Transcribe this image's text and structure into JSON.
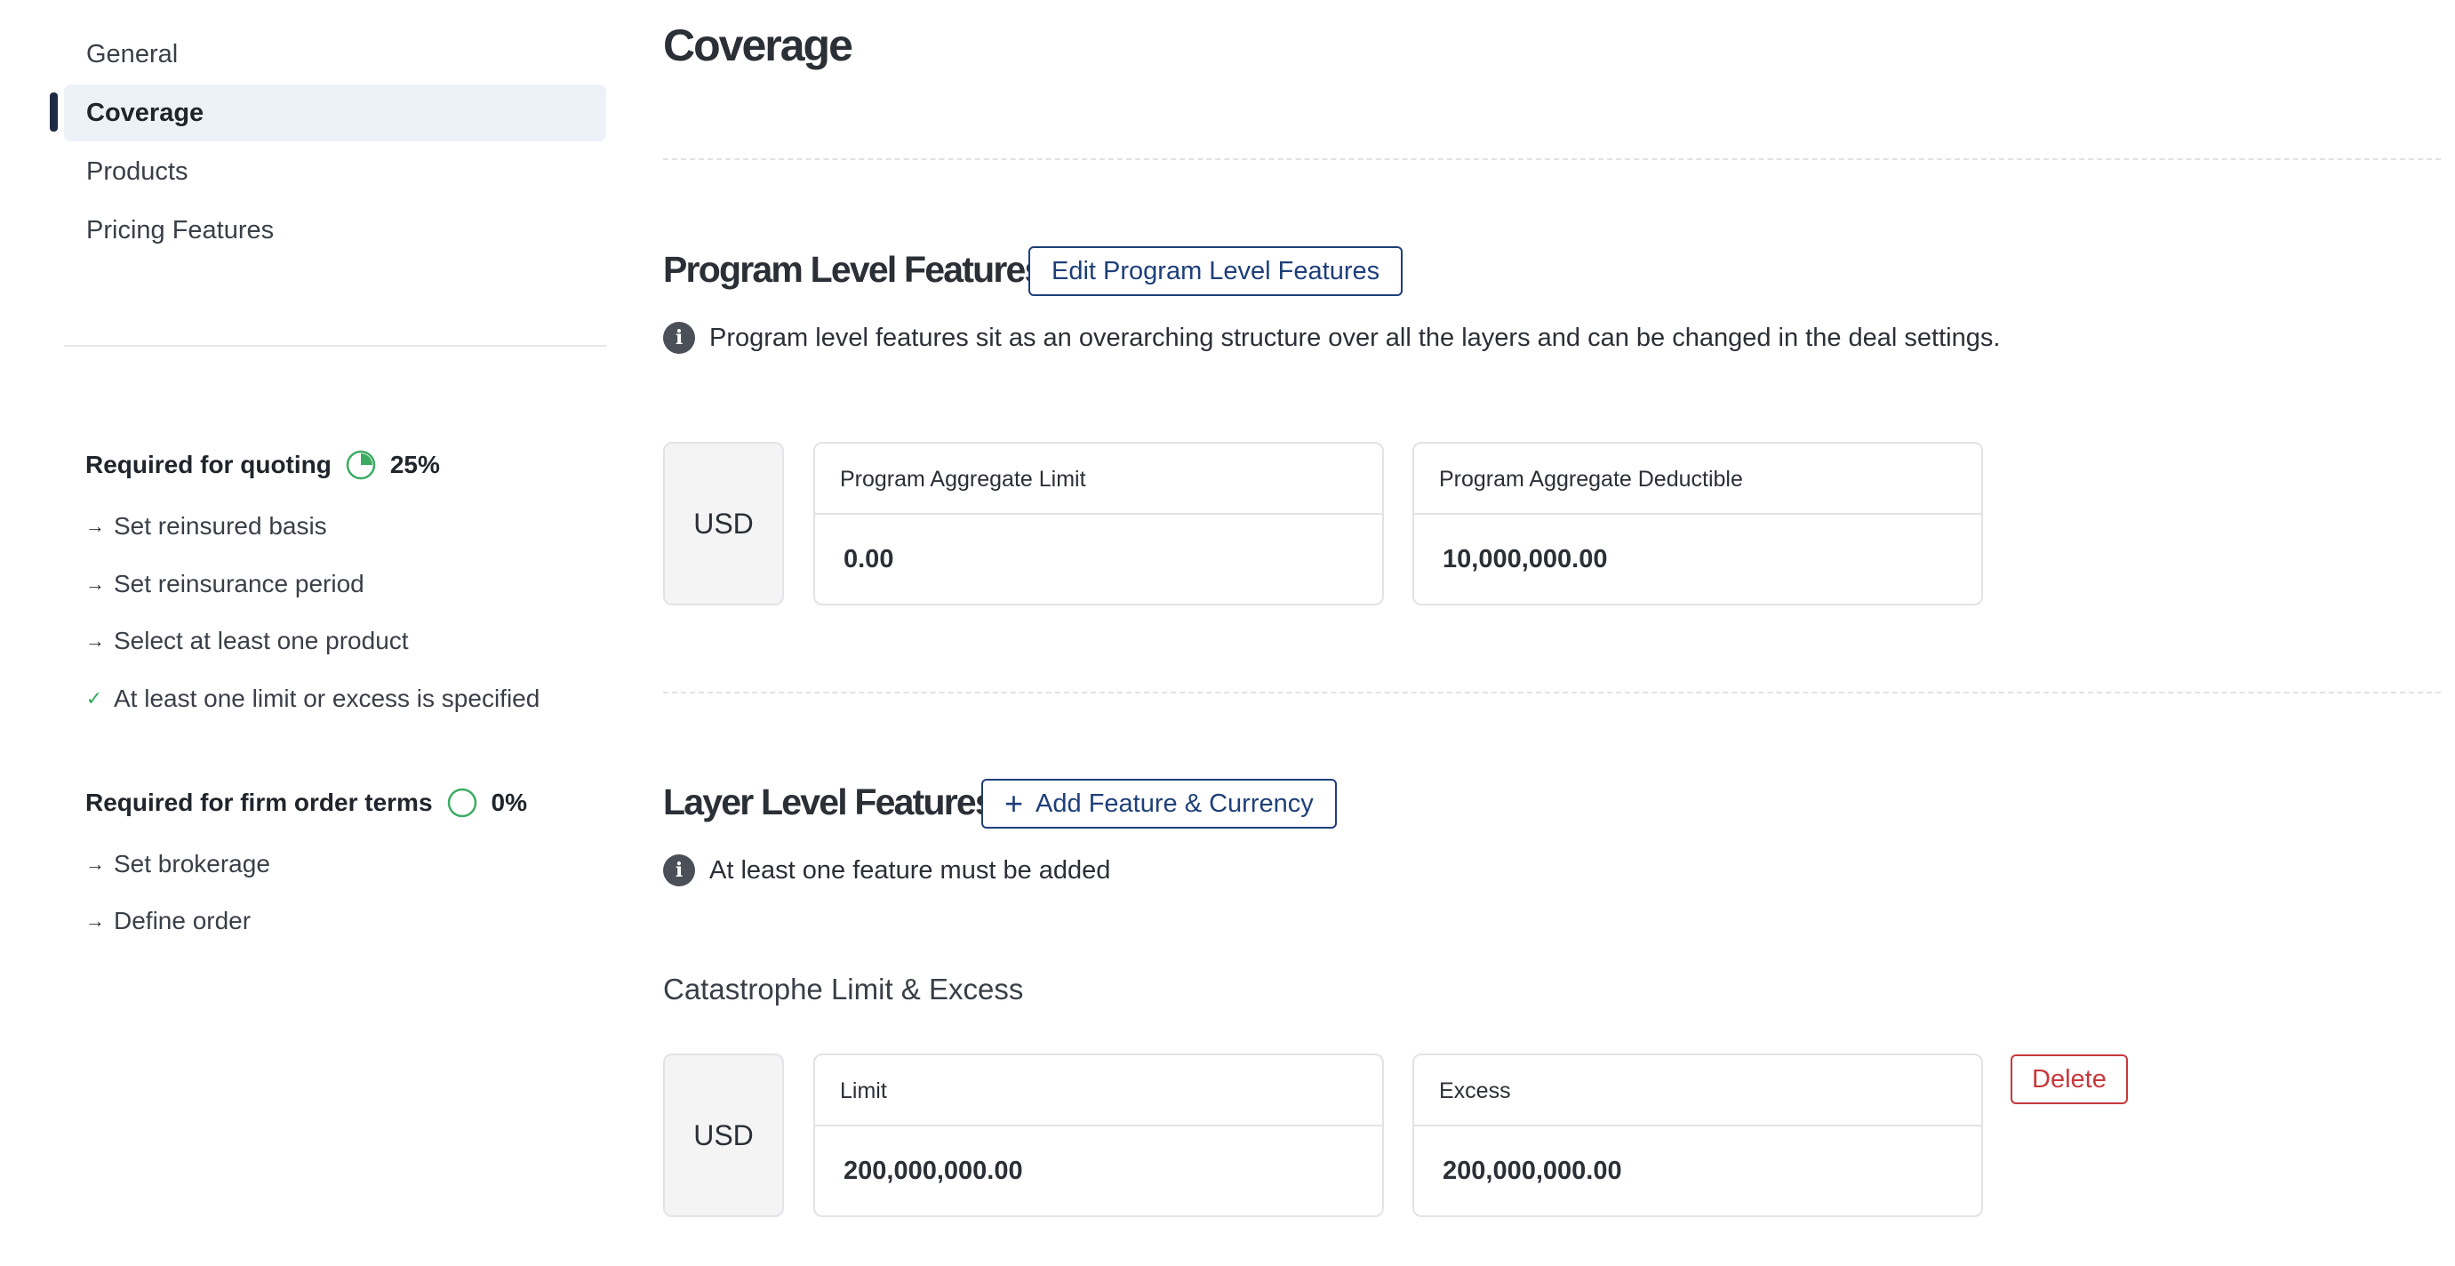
{
  "sidebar": {
    "nav": [
      {
        "label": "General"
      },
      {
        "label": "Coverage"
      },
      {
        "label": "Products"
      },
      {
        "label": "Pricing Features"
      }
    ],
    "quoting": {
      "title": "Required for quoting",
      "percent": "25%",
      "progress": 0.25,
      "items": [
        {
          "label": "Set reinsured basis",
          "done": false
        },
        {
          "label": "Set reinsurance period",
          "done": false
        },
        {
          "label": "Select at least one product",
          "done": false
        },
        {
          "label": "At least one limit or excess is specified",
          "done": true
        }
      ]
    },
    "firm_order": {
      "title": "Required for firm order terms",
      "percent": "0%",
      "progress": 0,
      "items": [
        {
          "label": "Set brokerage",
          "done": false
        },
        {
          "label": "Define order",
          "done": false
        }
      ]
    }
  },
  "main": {
    "title": "Coverage",
    "program": {
      "title": "Program Level Features",
      "button": "Edit Program Level Features",
      "info": "Program level features sit as an overarching structure over all the layers and can be changed in the deal settings.",
      "currency": "USD",
      "fields": [
        {
          "label": "Program Aggregate Limit",
          "value": "0.00"
        },
        {
          "label": "Program Aggregate Deductible",
          "value": "10,000,000.00"
        }
      ]
    },
    "layer": {
      "title": "Layer Level Features",
      "button": "Add Feature & Currency",
      "info": "At least one feature must be added",
      "feature": {
        "title": "Catastrophe Limit & Excess",
        "currency": "USD",
        "fields": [
          {
            "label": "Limit",
            "value": "200,000,000.00"
          },
          {
            "label": "Excess",
            "value": "200,000,000.00"
          }
        ],
        "delete_label": "Delete"
      }
    }
  },
  "colors": {
    "accent": "#1e3f7a",
    "success": "#3cab62",
    "danger": "#c8383b",
    "active_bg": "#edf1f8"
  }
}
